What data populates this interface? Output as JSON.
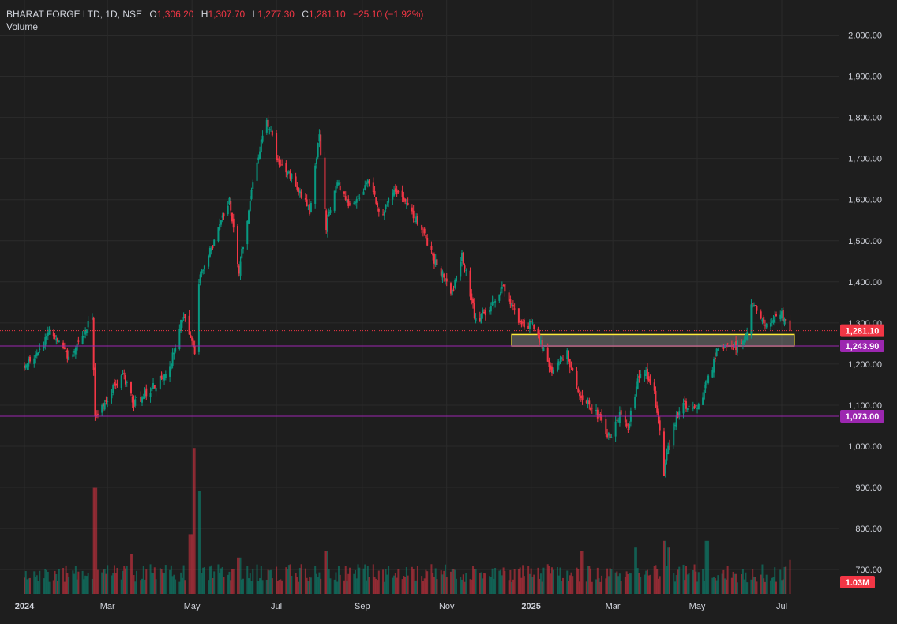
{
  "header": {
    "symbol": "BHARAT FORGE LTD, 1D, NSE",
    "open_label": "O",
    "open": "1,306.20",
    "high_label": "H",
    "high": "1,307.70",
    "low_label": "L",
    "low": "1,277.30",
    "close_label": "C",
    "close": "1,281.10",
    "change": "−25.10 (−1.92%)",
    "volume_label": "Volume"
  },
  "colors": {
    "background": "#1e1e1e",
    "up": "#089981",
    "down": "#f23645",
    "grid": "#2b2b2b",
    "axis_text": "#d1d4dc",
    "support_line": "#9c27b0",
    "zone_border": "#ffeb3b"
  },
  "chart_data": {
    "type": "candlestick",
    "title": "BHARAT FORGE LTD, 1D, NSE",
    "xlabel": "",
    "ylabel": "",
    "ylim": [
      650,
      2050
    ],
    "y_ticks": [
      "2,000.00",
      "1,900.00",
      "1,800.00",
      "1,700.00",
      "1,600.00",
      "1,500.00",
      "1,400.00",
      "1,300.00",
      "1,200.00",
      "1,100.00",
      "1,000.00",
      "900.00",
      "800.00",
      "700.00"
    ],
    "x_ticks": [
      "2024",
      "Mar",
      "May",
      "Jul",
      "Sep",
      "Nov",
      "2025",
      "Mar",
      "May",
      "Jul"
    ],
    "grid": true,
    "price_path": [
      [
        "2024-01-01",
        1190
      ],
      [
        "2024-01-10",
        1225
      ],
      [
        "2024-01-20",
        1280
      ],
      [
        "2024-02-01",
        1215
      ],
      [
        "2024-02-10",
        1255
      ],
      [
        "2024-02-19",
        1315
      ],
      [
        "2024-02-21",
        1075
      ],
      [
        "2024-03-05",
        1140
      ],
      [
        "2024-03-12",
        1175
      ],
      [
        "2024-03-20",
        1105
      ],
      [
        "2024-04-01",
        1135
      ],
      [
        "2024-04-15",
        1190
      ],
      [
        "2024-04-25",
        1325
      ],
      [
        "2024-05-03",
        1230
      ],
      [
        "2024-05-05",
        1395
      ],
      [
        "2024-05-15",
        1480
      ],
      [
        "2024-05-28",
        1595
      ],
      [
        "2024-06-04",
        1430
      ],
      [
        "2024-06-14",
        1640
      ],
      [
        "2024-06-24",
        1800
      ],
      [
        "2024-07-03",
        1680
      ],
      [
        "2024-07-14",
        1650
      ],
      [
        "2024-07-25",
        1570
      ],
      [
        "2024-08-01",
        1760
      ],
      [
        "2024-08-06",
        1530
      ],
      [
        "2024-08-13",
        1640
      ],
      [
        "2024-08-25",
        1580
      ],
      [
        "2024-09-05",
        1640
      ],
      [
        "2024-09-15",
        1565
      ],
      [
        "2024-09-25",
        1620
      ],
      [
        "2024-10-05",
        1580
      ],
      [
        "2024-10-15",
        1515
      ],
      [
        "2024-10-25",
        1440
      ],
      [
        "2024-11-05",
        1375
      ],
      [
        "2024-11-12",
        1470
      ],
      [
        "2024-11-22",
        1305
      ],
      [
        "2024-12-02",
        1335
      ],
      [
        "2024-12-12",
        1390
      ],
      [
        "2024-12-24",
        1300
      ],
      [
        "2025-01-03",
        1295
      ],
      [
        "2025-01-15",
        1185
      ],
      [
        "2025-01-27",
        1225
      ],
      [
        "2025-02-03",
        1140
      ],
      [
        "2025-02-17",
        1080
      ],
      [
        "2025-02-28",
        1015
      ],
      [
        "2025-03-06",
        1085
      ],
      [
        "2025-03-12",
        1040
      ],
      [
        "2025-03-17",
        1130
      ],
      [
        "2025-03-22",
        1200
      ],
      [
        "2025-03-31",
        1130
      ],
      [
        "2025-04-04",
        1030
      ],
      [
        "2025-04-07",
        935
      ],
      [
        "2025-04-10",
        1000
      ],
      [
        "2025-04-14",
        1050
      ],
      [
        "2025-04-21",
        1100
      ],
      [
        "2025-05-02",
        1095
      ],
      [
        "2025-05-10",
        1175
      ],
      [
        "2025-05-17",
        1250
      ],
      [
        "2025-05-27",
        1235
      ],
      [
        "2025-06-05",
        1270
      ],
      [
        "2025-06-10",
        1355
      ],
      [
        "2025-06-20",
        1290
      ],
      [
        "2025-07-01",
        1320
      ],
      [
        "2025-07-07",
        1281
      ]
    ],
    "volume_unit": "M",
    "volume_spikes": [
      [
        "2024-02-21",
        3.2
      ],
      [
        "2024-03-18",
        1.2
      ],
      [
        "2024-04-30",
        1.8
      ],
      [
        "2024-05-03",
        4.4
      ],
      [
        "2024-05-06",
        3.1
      ],
      [
        "2024-06-04",
        1.1
      ],
      [
        "2024-08-06",
        1.3
      ],
      [
        "2025-02-07",
        1.3
      ],
      [
        "2025-03-17",
        1.4
      ],
      [
        "2025-04-07",
        1.6
      ],
      [
        "2025-04-11",
        1.4
      ],
      [
        "2025-05-08",
        1.6
      ]
    ],
    "last_price": "1,281.10",
    "last_price_line": 1281.1,
    "last_volume": "1.03M",
    "horizontal_lines": [
      {
        "value": 1243.9,
        "label": "1,243.90",
        "color": "#9c27b0"
      },
      {
        "value": 1073.0,
        "label": "1,073.00",
        "color": "#9c27b0"
      }
    ],
    "zone": {
      "from_date": "2024-12-18",
      "to_date": "2025-07-10",
      "low": 1243.9,
      "high": 1272
    }
  }
}
